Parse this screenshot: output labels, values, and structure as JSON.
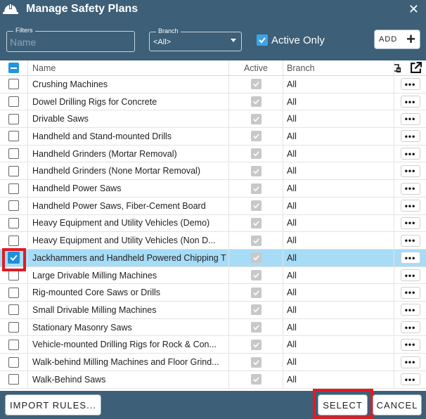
{
  "window": {
    "title": "Manage Safety Plans",
    "close_glyph": "✕"
  },
  "filters": {
    "filters_legend": "Filters",
    "name_placeholder": "Name",
    "branch_legend": "Branch",
    "branch_value": "<All>",
    "active_only_label": "Active Only",
    "active_only_checked": true,
    "add_label": "ADD",
    "add_glyph": "+"
  },
  "grid": {
    "columns": {
      "name": "Name",
      "active": "Active",
      "branch": "Branch"
    },
    "rows": [
      {
        "name": "Crushing Machines",
        "branch": "All",
        "selected": false
      },
      {
        "name": "Dowel Drilling Rigs for Concrete",
        "branch": "All",
        "selected": false
      },
      {
        "name": "Drivable Saws",
        "branch": "All",
        "selected": false
      },
      {
        "name": "Handheld and Stand-mounted Drills",
        "branch": "All",
        "selected": false
      },
      {
        "name": "Handheld Grinders (Mortar Removal)",
        "branch": "All",
        "selected": false
      },
      {
        "name": "Handheld Grinders (None Mortar Removal)",
        "branch": "All",
        "selected": false
      },
      {
        "name": "Handheld Power Saws",
        "branch": "All",
        "selected": false
      },
      {
        "name": "Handheld Power Saws, Fiber-Cement Board",
        "branch": "All",
        "selected": false
      },
      {
        "name": "Heavy Equipment and Utility Vehicles (Demo)",
        "branch": "All",
        "selected": false
      },
      {
        "name": "Heavy Equipment and Utility Vehicles (Non D...",
        "branch": "All",
        "selected": false
      },
      {
        "name": "Jackhammers and Handheld Powered Chipping T",
        "branch": "All",
        "selected": true
      },
      {
        "name": "Large Drivable Milling Machines",
        "branch": "All",
        "selected": false
      },
      {
        "name": "Rig-mounted Core Saws or Drills",
        "branch": "All",
        "selected": false
      },
      {
        "name": "Small Drivable Milling Machines",
        "branch": "All",
        "selected": false
      },
      {
        "name": "Stationary Masonry Saws",
        "branch": "All",
        "selected": false
      },
      {
        "name": "Vehicle-mounted Drilling Rigs for Rock & Con...",
        "branch": "All",
        "selected": false
      },
      {
        "name": "Walk-behind Milling Machines and Floor Grind...",
        "branch": "All",
        "selected": false
      },
      {
        "name": "Walk-Behind Saws",
        "branch": "All",
        "selected": false
      }
    ],
    "more_glyph": "•••"
  },
  "footer": {
    "import_label": "IMPORT RULES...",
    "select_label": "SELECT",
    "cancel_label": "CANCEL"
  },
  "colors": {
    "chrome": "#3d5f78",
    "selected_row": "#a7dcf7",
    "checkbox_blue": "#1f8fd9",
    "highlight_red": "#e01c22"
  }
}
